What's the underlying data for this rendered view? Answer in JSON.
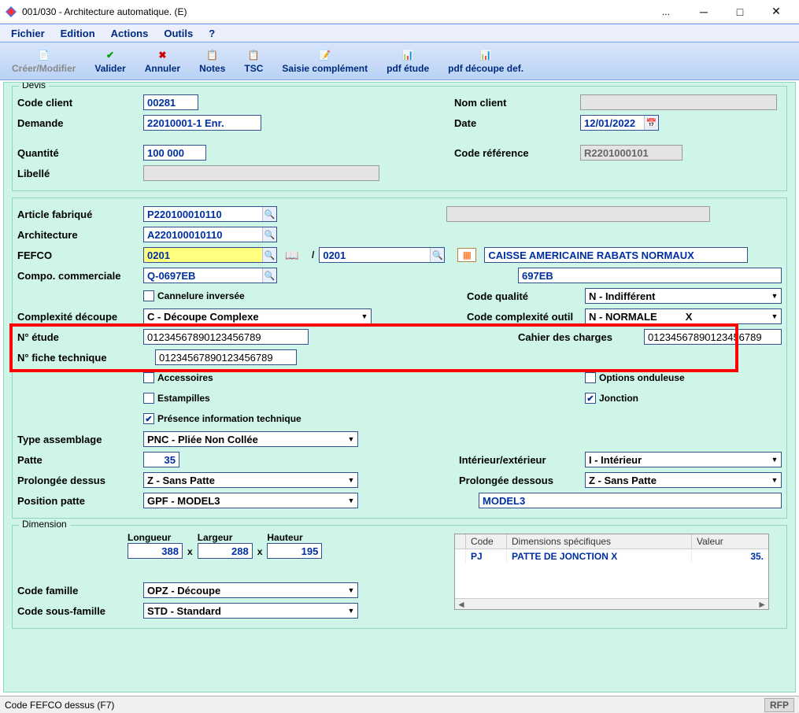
{
  "titlebar": {
    "title": "001/030 - Architecture automatique. (E)",
    "ellipsis": "..."
  },
  "menu": {
    "fichier": "Fichier",
    "edition": "Edition",
    "actions": "Actions",
    "outils": "Outils",
    "help": "?"
  },
  "toolbar": {
    "creer": "Créer/Modifier",
    "valider": "Valider",
    "annuler": "Annuler",
    "notes": "Notes",
    "tsc": "TSC",
    "saisie": "Saisie complément",
    "pdf_etude": "pdf étude",
    "pdf_decoupe": "pdf découpe def."
  },
  "devis": {
    "legend": "Devis",
    "code_client_label": "Code client",
    "code_client": "00281",
    "nom_client_label": "Nom client",
    "nom_client": "",
    "demande_label": "Demande",
    "demande": "22010001-1 Enr.",
    "date_label": "Date",
    "date": "12/01/2022",
    "quantite_label": "Quantité",
    "quantite": "100 000",
    "code_ref_label": "Code référence",
    "code_ref": "R2201000101",
    "libelle_label": "Libellé",
    "libelle": ""
  },
  "section2": {
    "article_label": "Article fabriqué",
    "article": "P220100010110",
    "architecture_label": "Architecture",
    "architecture": "A220100010110",
    "fefco_label": "FEFCO",
    "fefco1": "0201",
    "fefco_sep": "/",
    "fefco2": "0201",
    "fefco_desc": "CAISSE AMERICAINE RABATS NORMAUX",
    "compo_label": "Compo. commerciale",
    "compo": "Q-0697EB",
    "compo_desc": "697EB",
    "cannelure_label": "Cannelure inversée",
    "code_qualite_label": "Code qualité",
    "code_qualite": "N - Indifférent",
    "complexite_label": "Complexité découpe",
    "complexite": "C - Découpe Complexe",
    "code_comp_outil_label": "Code complexité outil",
    "code_comp_outil": "N - NORMALE          X",
    "n_etude_label": "N° étude",
    "n_etude": "01234567890123456789",
    "cahier_charges_label": "Cahier des charges",
    "cahier_charges": "01234567890123456789",
    "n_fiche_label": "N° fiche technique",
    "n_fiche": "01234567890123456789",
    "accessoires_label": "Accessoires",
    "options_onduleuse_label": "Options onduleuse",
    "estampilles_label": "Estampilles",
    "jonction_label": "Jonction",
    "presence_info_label": "Présence information technique",
    "type_assemblage_label": "Type assemblage",
    "type_assemblage": "PNC - Pliée Non Collée",
    "patte_label": "Patte",
    "patte": "35",
    "interieur_ext_label": "Intérieur/extérieur",
    "interieur_ext": "I - Intérieur",
    "prolongee_dessus_label": "Prolongée dessus",
    "prolongee_dessus": "Z - Sans Patte",
    "prolongee_dessous_label": "Prolongée dessous",
    "prolongee_dessous": "Z - Sans Patte",
    "position_patte_label": "Position patte",
    "position_patte": "GPF - MODEL3",
    "position_patte_desc": "MODEL3"
  },
  "dimension": {
    "legend": "Dimension",
    "longueur_label": "Longueur",
    "longueur": "388",
    "x": "x",
    "largeur_label": "Largeur",
    "largeur": "288",
    "hauteur_label": "Hauteur",
    "hauteur": "195",
    "table": {
      "col_code": "Code",
      "col_dims": "Dimensions spécifiques",
      "col_valeur": "Valeur",
      "row0_code": "PJ",
      "row0_dims": "PATTE DE JONCTION      X",
      "row0_val": "35."
    },
    "code_famille_label": "Code famille",
    "code_famille": "OPZ - Découpe",
    "code_sous_famille_label": "Code sous-famille",
    "code_sous_famille": "STD - Standard"
  },
  "statusbar": {
    "left": "Code FEFCO dessus (F7)",
    "right": "RFP"
  }
}
